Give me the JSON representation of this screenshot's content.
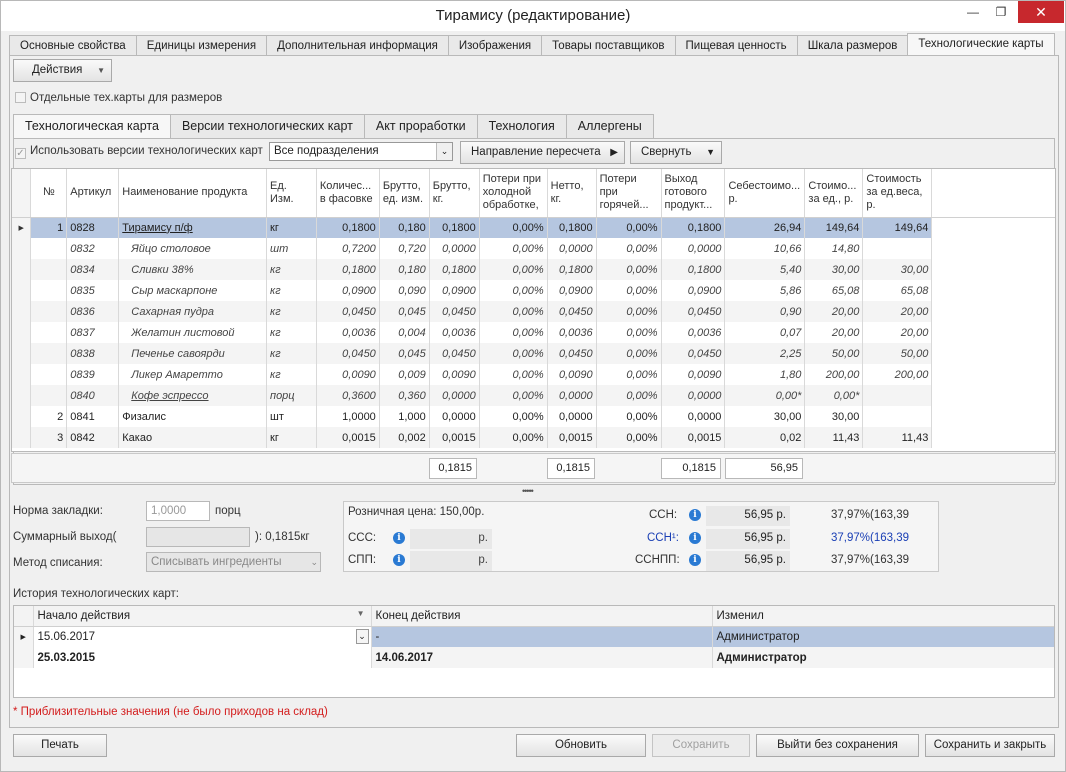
{
  "window": {
    "title": "Тирамису (редактирование)",
    "minimize": "—",
    "maximize": "❐",
    "close": "✕"
  },
  "top_tabs": [
    {
      "label": "Основные свойства"
    },
    {
      "label": "Единицы измерения"
    },
    {
      "label": "Дополнительная информация"
    },
    {
      "label": "Изображения"
    },
    {
      "label": "Товары поставщиков"
    },
    {
      "label": "Пищевая ценность"
    },
    {
      "label": "Шкала размеров"
    },
    {
      "label": "Технологические карты",
      "active": true
    }
  ],
  "actions_button": "Действия",
  "separate_cards_checkbox": "Отдельные тех.карты для размеров",
  "inner_tabs": [
    {
      "label": "Технологическая карта",
      "active": true
    },
    {
      "label": "Версии технологических карт"
    },
    {
      "label": "Акт проработки"
    },
    {
      "label": "Технология"
    },
    {
      "label": "Аллергены"
    }
  ],
  "toolbar": {
    "use_versions_checkbox": "Использовать версии технологических карт",
    "department_select": "Все подразделения",
    "recalc_button": "Направление пересчета",
    "collapse_button": "Свернуть"
  },
  "table": {
    "columns": [
      "№",
      "Артикул",
      "Наименование продукта",
      "Ед. Изм.",
      "Количес... в фасовке",
      "Брутто, ед. изм.",
      "Брутто, кг.",
      "Потери при холодной обработке,",
      "Нетто, кг.",
      "Потери при горячей...",
      "Выход готового продукт...",
      "Себестоимо... р.",
      "Стоимо... за ед., р.",
      "Стоимость за ед.веса, р."
    ],
    "rows": [
      {
        "type": "main",
        "num": "1",
        "code": "0828",
        "name": "Тирамису п/ф",
        "unit": "кг",
        "qty": "0,1800",
        "gross_u": "0,180",
        "gross_kg": "0,1800",
        "cold": "0,00%",
        "net": "0,1800",
        "hot": "0,00%",
        "out": "0,1800",
        "cost": "26,94",
        "price_u": "149,64",
        "price_w": "149,64"
      },
      {
        "type": "ing",
        "num": "",
        "code": "0832",
        "name": "Яйцо столовое",
        "unit": "шт",
        "qty": "0,7200",
        "gross_u": "0,720",
        "gross_kg": "0,0000",
        "cold": "0,00%",
        "net": "0,0000",
        "hot": "0,00%",
        "out": "0,0000",
        "cost": "10,66",
        "price_u": "14,80",
        "price_w": ""
      },
      {
        "type": "ing",
        "num": "",
        "code": "0834",
        "name": "Сливки 38%",
        "unit": "кг",
        "qty": "0,1800",
        "gross_u": "0,180",
        "gross_kg": "0,1800",
        "cold": "0,00%",
        "net": "0,1800",
        "hot": "0,00%",
        "out": "0,1800",
        "cost": "5,40",
        "price_u": "30,00",
        "price_w": "30,00"
      },
      {
        "type": "ing",
        "num": "",
        "code": "0835",
        "name": "Сыр маскарпоне",
        "unit": "кг",
        "qty": "0,0900",
        "gross_u": "0,090",
        "gross_kg": "0,0900",
        "cold": "0,00%",
        "net": "0,0900",
        "hot": "0,00%",
        "out": "0,0900",
        "cost": "5,86",
        "price_u": "65,08",
        "price_w": "65,08"
      },
      {
        "type": "ing",
        "num": "",
        "code": "0836",
        "name": "Сахарная пудра",
        "unit": "кг",
        "qty": "0,0450",
        "gross_u": "0,045",
        "gross_kg": "0,0450",
        "cold": "0,00%",
        "net": "0,0450",
        "hot": "0,00%",
        "out": "0,0450",
        "cost": "0,90",
        "price_u": "20,00",
        "price_w": "20,00"
      },
      {
        "type": "ing",
        "num": "",
        "code": "0837",
        "name": "Желатин листовой",
        "unit": "кг",
        "qty": "0,0036",
        "gross_u": "0,004",
        "gross_kg": "0,0036",
        "cold": "0,00%",
        "net": "0,0036",
        "hot": "0,00%",
        "out": "0,0036",
        "cost": "0,07",
        "price_u": "20,00",
        "price_w": "20,00"
      },
      {
        "type": "ing",
        "num": "",
        "code": "0838",
        "name": "Печенье савоярди",
        "unit": "кг",
        "qty": "0,0450",
        "gross_u": "0,045",
        "gross_kg": "0,0450",
        "cold": "0,00%",
        "net": "0,0450",
        "hot": "0,00%",
        "out": "0,0450",
        "cost": "2,25",
        "price_u": "50,00",
        "price_w": "50,00"
      },
      {
        "type": "ing",
        "num": "",
        "code": "0839",
        "name": "Ликер Амаретто",
        "unit": "кг",
        "qty": "0,0090",
        "gross_u": "0,009",
        "gross_kg": "0,0090",
        "cold": "0,00%",
        "net": "0,0090",
        "hot": "0,00%",
        "out": "0,0090",
        "cost": "1,80",
        "price_u": "200,00",
        "price_w": "200,00"
      },
      {
        "type": "ing link",
        "num": "",
        "code": "0840",
        "name": "Кофе эспрессо",
        "unit": "порц",
        "qty": "0,3600",
        "gross_u": "0,360",
        "gross_kg": "0,0000",
        "cold": "0,00%",
        "net": "0,0000",
        "hot": "0,00%",
        "out": "0,0000",
        "cost": "0,00*",
        "price_u": "0,00*",
        "price_w": ""
      },
      {
        "type": "plain",
        "num": "2",
        "code": "0841",
        "name": "Физалис",
        "unit": "шт",
        "qty": "1,0000",
        "gross_u": "1,000",
        "gross_kg": "0,0000",
        "cold": "0,00%",
        "net": "0,0000",
        "hot": "0,00%",
        "out": "0,0000",
        "cost": "30,00",
        "price_u": "30,00",
        "price_w": ""
      },
      {
        "type": "plain",
        "num": "3",
        "code": "0842",
        "name": "Какао",
        "unit": "кг",
        "qty": "0,0015",
        "gross_u": "0,002",
        "gross_kg": "0,0015",
        "cold": "0,00%",
        "net": "0,0015",
        "hot": "0,00%",
        "out": "0,0015",
        "cost": "0,02",
        "price_u": "11,43",
        "price_w": "11,43"
      }
    ],
    "totals": {
      "gross_kg": "0,1815",
      "net": "0,1815",
      "out": "0,1815",
      "cost": "56,95"
    }
  },
  "splitter": "•••••",
  "form": {
    "norm_label": "Норма закладки:",
    "norm_value": "1,0000",
    "norm_unit": "порц",
    "total_output_label": "Суммарный выход(",
    "total_output_suffix": "): 0,1815кг",
    "writeoff_label": "Метод списания:",
    "writeoff_value": "Списывать ингредиенты"
  },
  "prices": {
    "retail": "Розничная цена:  150,00р.",
    "ccc_label": "ССС:",
    "ccc_unit": "р.",
    "cpp_label": "СПП:",
    "cpp_unit": "р.",
    "csn_label": "ССН:",
    "csn_value": "56,95 р.",
    "csn_pct": "37,97%(163,39",
    "csn2_label": "ССН¹:",
    "csn2_value": "56,95 р.",
    "csn2_pct": "37,97%(163,39",
    "csnpp_label": "ССНПП:",
    "csnpp_value": "56,95 р.",
    "csnpp_pct": "37,97%(163,39"
  },
  "history": {
    "label": "История технологических карт:",
    "columns": [
      "Начало действия",
      "Конец действия",
      "Изменил"
    ],
    "rows": [
      {
        "start": "15.06.2017",
        "end": "-",
        "by": "Администратор"
      },
      {
        "start": "25.03.2015",
        "end": "14.06.2017",
        "by": "Администратор"
      }
    ]
  },
  "note": "* Приблизительные значения (не было приходов на склад)",
  "buttons": {
    "print": "Печать",
    "refresh": "Обновить",
    "save": "Сохранить",
    "exit": "Выйти без сохранения",
    "save_close": "Сохранить и закрыть"
  },
  "colors": {
    "selection": "#b5c6e0",
    "close_button": "#c7282d",
    "note": "#d31c1c",
    "info_icon": "#2a7ad3"
  }
}
